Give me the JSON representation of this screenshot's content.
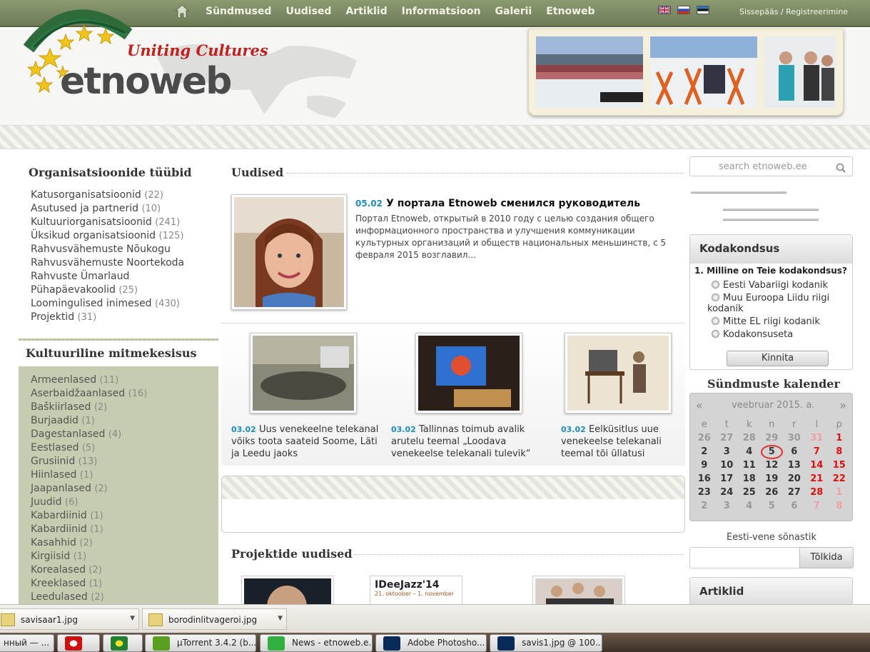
{
  "nav": {
    "links": [
      "Sündmused",
      "Uudised",
      "Artiklid",
      "Informatsioon",
      "Galerii",
      "Etnoweb"
    ],
    "login": "Sissepääs / Registreerimine"
  },
  "logo": {
    "tagline": "Uniting Cultures",
    "brand": "etnoweb"
  },
  "left": {
    "org_title": "Organisatsioonide tüübid",
    "org_types": [
      {
        "name": "Katusorganisatsioonid",
        "count": "(22)"
      },
      {
        "name": "Asutused ja partnerid",
        "count": "(10)"
      },
      {
        "name": "Kultuuriorganisatsioonid",
        "count": "(241)"
      },
      {
        "name": "Üksikud organisatsioonid",
        "count": "(125)"
      },
      {
        "name": "Rahvusvähemuste Nõukogu",
        "count": ""
      },
      {
        "name": "Rahvusvähemuste Noortekoda",
        "count": ""
      },
      {
        "name": "Rahvuste Ümarlaud",
        "count": ""
      },
      {
        "name": "Pühapäevakoolid",
        "count": "(25)"
      },
      {
        "name": "Loomingulised inimesed",
        "count": "(430)"
      },
      {
        "name": "Projektid",
        "count": "(31)"
      }
    ],
    "culture_title": "Kultuuriline mitmekesisus",
    "cultures": [
      {
        "name": "Armeenlased",
        "count": "(11)"
      },
      {
        "name": "Aserbaidžaanlased",
        "count": "(16)"
      },
      {
        "name": "Baškiirlased",
        "count": "(2)"
      },
      {
        "name": "Burjaadid",
        "count": "(1)"
      },
      {
        "name": "Dagestanlased",
        "count": "(4)"
      },
      {
        "name": "Eestlased",
        "count": "(5)"
      },
      {
        "name": "Grusiinid",
        "count": "(13)"
      },
      {
        "name": "Hiinlased",
        "count": "(1)"
      },
      {
        "name": "Jaapanlased",
        "count": "(2)"
      },
      {
        "name": "Juudid",
        "count": "(6)"
      },
      {
        "name": "Kabardiinid",
        "count": "(1)"
      },
      {
        "name": "Kabardiinid",
        "count": "(1)"
      },
      {
        "name": "Kasahhid",
        "count": "(2)"
      },
      {
        "name": "Kirgiisid",
        "count": "(1)"
      },
      {
        "name": "Korealased",
        "count": "(2)"
      },
      {
        "name": "Kreeklased",
        "count": "(1)"
      },
      {
        "name": "Leedulased",
        "count": "(2)"
      }
    ]
  },
  "news": {
    "title": "Uudised",
    "main": {
      "date": "05.02",
      "title": "У портала Etnoweb сменился руководитель",
      "text": "Портал Etnoweb, открытый в 2010 году с целью создания общего информационного пространства и улучшения коммуникации культурных организаций и обществ национальных меньшинств, с 5 февраля 2015 возглавил..."
    },
    "items": [
      {
        "date": "03.02",
        "text": "Uus venekeelne telekanal võiks toota saateid Soome, Läti ja Leedu jaoks"
      },
      {
        "date": "03.02",
        "text": "Tallinnas toimub avalik arutelu teemal „Loodava venekeelse telekanali tulevik“"
      },
      {
        "date": "03.02",
        "text": "Eelküsitlus uue venekeelse telekanali teemal tõi üllatusi"
      }
    ],
    "projects_title": "Projektide uudised",
    "project_thumb_text": {
      "title": "IDeeJazz'14",
      "sub": "21. oktoober – 1. november"
    }
  },
  "right": {
    "search_placeholder": "search etnoweb.ee",
    "poll": {
      "title": "Kodakondsus",
      "question": "1. Milline on Teie kodakondsus?",
      "options": [
        "Eesti Vabariigi kodanik",
        "Muu Euroopa Liidu riigi kodanik",
        "Mitte EL riigi kodanik",
        "Kodakonsuseta"
      ],
      "button": "Kinnita"
    },
    "calendar": {
      "title": "Sündmuste kalender",
      "month": "veebruar 2015. a.",
      "prev": "«",
      "next": "»",
      "weekdays": [
        "e",
        "t",
        "k",
        "n",
        "r",
        "l",
        "p"
      ],
      "weeks": [
        [
          "26",
          "27",
          "28",
          "29",
          "30",
          "31",
          "1"
        ],
        [
          "2",
          "3",
          "4",
          "5",
          "6",
          "7",
          "8"
        ],
        [
          "9",
          "10",
          "11",
          "12",
          "13",
          "14",
          "15"
        ],
        [
          "16",
          "17",
          "18",
          "19",
          "20",
          "21",
          "22"
        ],
        [
          "23",
          "24",
          "25",
          "26",
          "27",
          "28",
          "1"
        ],
        [
          "2",
          "3",
          "4",
          "5",
          "6",
          "7",
          "8"
        ]
      ],
      "today": "5"
    },
    "dictionary": {
      "title": "Eesti-vene sõnastik",
      "button": "Tõlkida"
    },
    "articles_title": "Artiklid"
  },
  "downloads": [
    "savisaar1.jpg",
    "borodinlitvageroi.jpg"
  ],
  "taskbar": [
    "нный — ...",
    "",
    "",
    "µTorrent 3.4.2  (b...",
    "News - etnoweb.e...",
    "Adobe Photosho...",
    "savis1.jpg @ 100..."
  ],
  "colors": {
    "nav_green": "#7a8862",
    "date_blue": "#1f8ac0",
    "weekend_red": "#e01010",
    "culture_bg": "#c5ccb0"
  }
}
